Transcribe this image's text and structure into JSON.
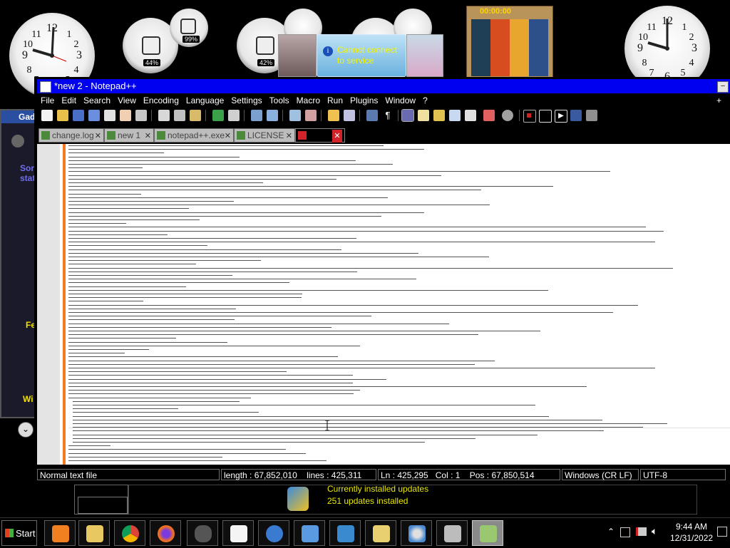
{
  "desktop": {
    "gauges": [
      {
        "name": "cpu-gauge-1",
        "percent_label": "44%"
      },
      {
        "name": "mem-gauge-1",
        "percent_label": "99%"
      },
      {
        "name": "cpu-gauge-2",
        "percent_label": "42%"
      }
    ],
    "notification": {
      "text_line1": "Cannot connect",
      "text_line2": "to service"
    },
    "puzzle_timer": "00:00:00",
    "updates": {
      "line1": "Currently installed updates",
      "line2": "251 updates installed"
    },
    "side_panel_fragments": [
      "Gad",
      "Sor",
      "stat",
      "Fe",
      "Wi"
    ]
  },
  "window": {
    "title": "*new 2 - Notepad++",
    "menu": [
      "File",
      "Edit",
      "Search",
      "View",
      "Encoding",
      "Language",
      "Settings",
      "Tools",
      "Macro",
      "Run",
      "Plugins",
      "Window",
      "?"
    ],
    "menu_extra": "+",
    "tabs": [
      {
        "label": "change.log",
        "active": false
      },
      {
        "label": "new 1",
        "active": false
      },
      {
        "label": "notepad++.exe",
        "active": false
      },
      {
        "label": "LICENSE",
        "active": false
      },
      {
        "label": "",
        "active": true
      }
    ],
    "status": {
      "type": "Normal text file",
      "length": "length : 67,852,010",
      "lines": "lines : 425,311",
      "ln": "Ln : 425,295",
      "col": "Col : 1",
      "pos": "Pos : 67,850,514",
      "eol": "Windows (CR LF)",
      "encoding": "UTF-8"
    }
  },
  "taskbar": {
    "start_label": "Start",
    "apps": [
      "media-player-icon",
      "file-explorer-icon",
      "chrome-icon",
      "firefox-icon",
      "mouse-icon",
      "solitaire-icon",
      "globe-icon",
      "control-panel-icon",
      "remote-desktop-icon",
      "folders-icon",
      "paint-icon",
      "scanner-icon",
      "notepadpp-icon"
    ],
    "clock_time": "9:44 AM",
    "clock_date": "12/31/2022"
  },
  "colors": {
    "titlebar": "#0000f0",
    "fold_margin": "#f57a1f",
    "active_tab_close": "#d2232a"
  }
}
